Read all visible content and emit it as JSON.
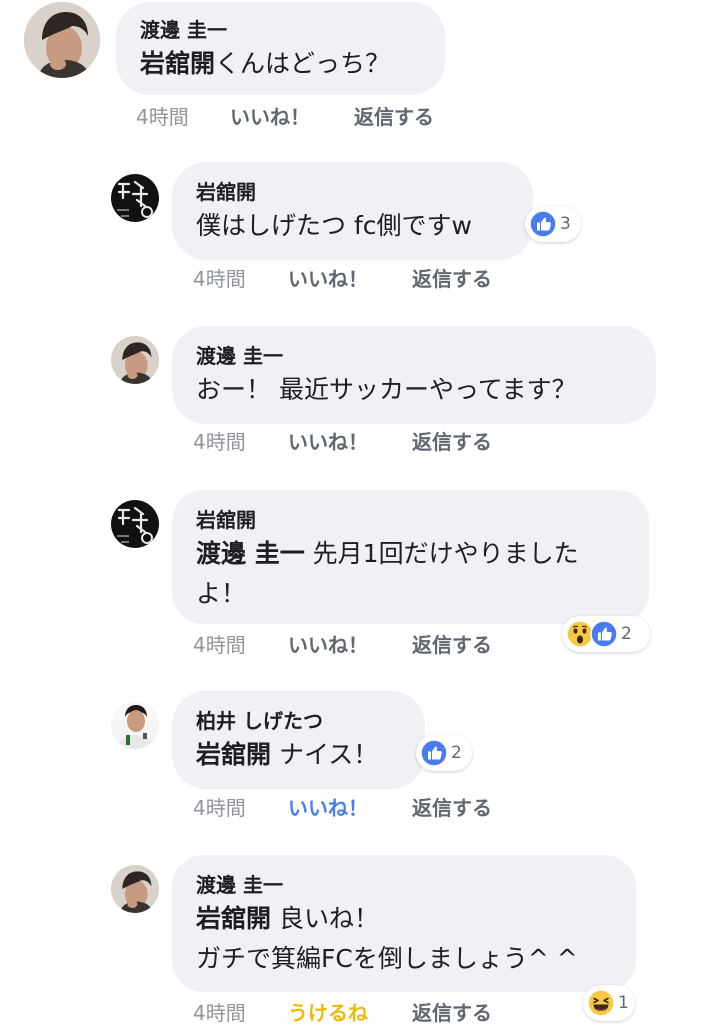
{
  "colors": {
    "bubble_bg": "#f0f1f4",
    "like_blue": "#4a7cf0",
    "haha_yellow": "#f0b90a",
    "meta_gray": "#90949c"
  },
  "comments": [
    {
      "author": "渡邊 圭一",
      "mention": "岩舘開",
      "text": "くんはどっち？",
      "time": "4時間",
      "like_label": "いいね！",
      "reply_label": "返信する",
      "avatar_icon": "man-portrait-avatar"
    },
    {
      "author": "岩舘開",
      "text": "僕はしげたつ fc側ですw",
      "time": "4時間",
      "like_label": "いいね！",
      "reply_label": "返信する",
      "reaction_count": "3",
      "reaction_icons": [
        "like-reaction-icon"
      ],
      "avatar_icon": "book-cover-avatar"
    },
    {
      "author": "渡邊 圭一",
      "text": "おー！ 最近サッカーやってます？",
      "time": "4時間",
      "like_label": "いいね！",
      "reply_label": "返信する",
      "avatar_icon": "man-portrait-avatar"
    },
    {
      "author": "岩舘開",
      "mention": "渡邊 圭一",
      "text_line1": "先月1回だけやりました",
      "text_line2": "よ！",
      "time": "4時間",
      "like_label": "いいね！",
      "reply_label": "返信する",
      "reaction_count": "2",
      "reaction_icons": [
        "wow-reaction-icon",
        "like-reaction-icon"
      ],
      "avatar_icon": "book-cover-avatar"
    },
    {
      "author": "柏井 しげたつ",
      "mention": "岩舘開",
      "text": "ナイス！",
      "time": "4時間",
      "like_label": "いいね！",
      "like_active": true,
      "reply_label": "返信する",
      "reaction_count": "2",
      "reaction_icons": [
        "like-reaction-icon"
      ],
      "avatar_icon": "speaker-portrait-avatar"
    },
    {
      "author": "渡邊 圭一",
      "mention": "岩舘開",
      "text_line1": "良いね！",
      "text_line2": "ガチで箕編FCを倒しましょう^ ^",
      "time": "4時間",
      "like_label": "うけるね",
      "reply_label": "返信する",
      "reaction_count": "1",
      "reaction_icons": [
        "haha-reaction-icon"
      ],
      "avatar_icon": "man-portrait-avatar"
    }
  ]
}
